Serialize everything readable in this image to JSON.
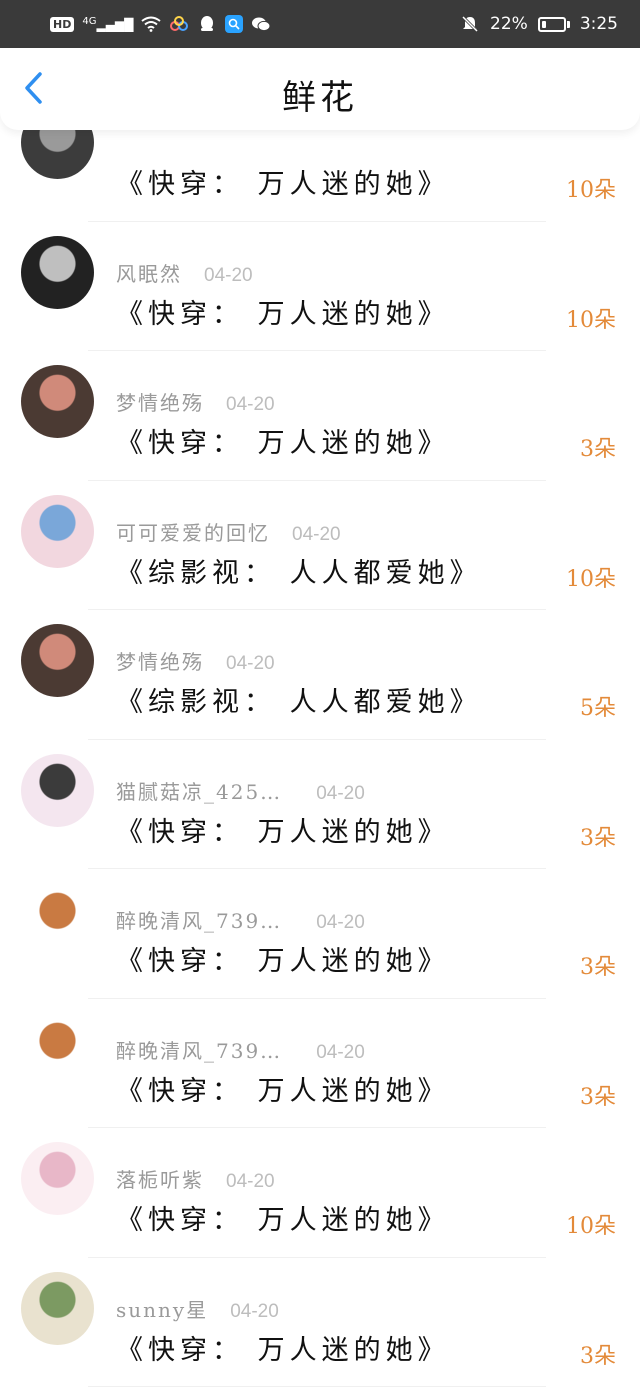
{
  "status_bar": {
    "hd": "HD",
    "signal": "4G",
    "battery_pct": "22%",
    "battery_level": 0.22,
    "time": "3:25",
    "icons": [
      "hd-icon",
      "signal-icon",
      "wifi-icon",
      "app-icon",
      "qq-icon",
      "search-icon",
      "wechat-icon",
      "mute-icon",
      "battery-icon"
    ]
  },
  "header": {
    "title": "鲜花",
    "back_icon": "chevron-left-icon"
  },
  "colors": {
    "accent": "#2f8ff0",
    "count": "#e38a39",
    "muted": "#9a9a9a"
  },
  "items": [
    {
      "user": "",
      "date": "",
      "book": "《快穿： 万人迷的她》",
      "count": "10朵",
      "avatar_colors": [
        "#3c3c3c",
        "#9a9a9a"
      ]
    },
    {
      "user": "风眠然",
      "date": "04-20",
      "book": "《快穿： 万人迷的她》",
      "count": "10朵",
      "avatar_colors": [
        "#222222",
        "#bfbfbf"
      ]
    },
    {
      "user": "梦情绝殇",
      "date": "04-20",
      "book": "《快穿： 万人迷的她》",
      "count": "3朵",
      "avatar_colors": [
        "#4b3a33",
        "#d08a7a"
      ]
    },
    {
      "user": "可可爱爱的回忆",
      "date": "04-20",
      "book": "《综影视： 人人都爱她》",
      "count": "10朵",
      "avatar_colors": [
        "#f2d7df",
        "#7aa7d9"
      ]
    },
    {
      "user": "梦情绝殇",
      "date": "04-20",
      "book": "《综影视： 人人都爱她》",
      "count": "5朵",
      "avatar_colors": [
        "#4b3a33",
        "#d08a7a"
      ]
    },
    {
      "user": "猫腻菇凉_425…",
      "date": "04-20",
      "book": "《快穿： 万人迷的她》",
      "count": "3朵",
      "avatar_colors": [
        "#f4e6ef",
        "#3b3b3b"
      ]
    },
    {
      "user": "醉晚清风_739…",
      "date": "04-20",
      "book": "《快穿： 万人迷的她》",
      "count": "3朵",
      "avatar_colors": [
        "#ffffff",
        "#c97a42"
      ]
    },
    {
      "user": "醉晚清风_739…",
      "date": "04-20",
      "book": "《快穿： 万人迷的她》",
      "count": "3朵",
      "avatar_colors": [
        "#ffffff",
        "#c97a42"
      ]
    },
    {
      "user": "落栀听紫",
      "date": "04-20",
      "book": "《快穿： 万人迷的她》",
      "count": "10朵",
      "avatar_colors": [
        "#fbeef2",
        "#e8b7c8"
      ]
    },
    {
      "user": "sunny星",
      "date": "04-20",
      "book": "《快穿： 万人迷的她》",
      "count": "3朵",
      "avatar_colors": [
        "#e9e2cf",
        "#7c9a62"
      ]
    }
  ]
}
